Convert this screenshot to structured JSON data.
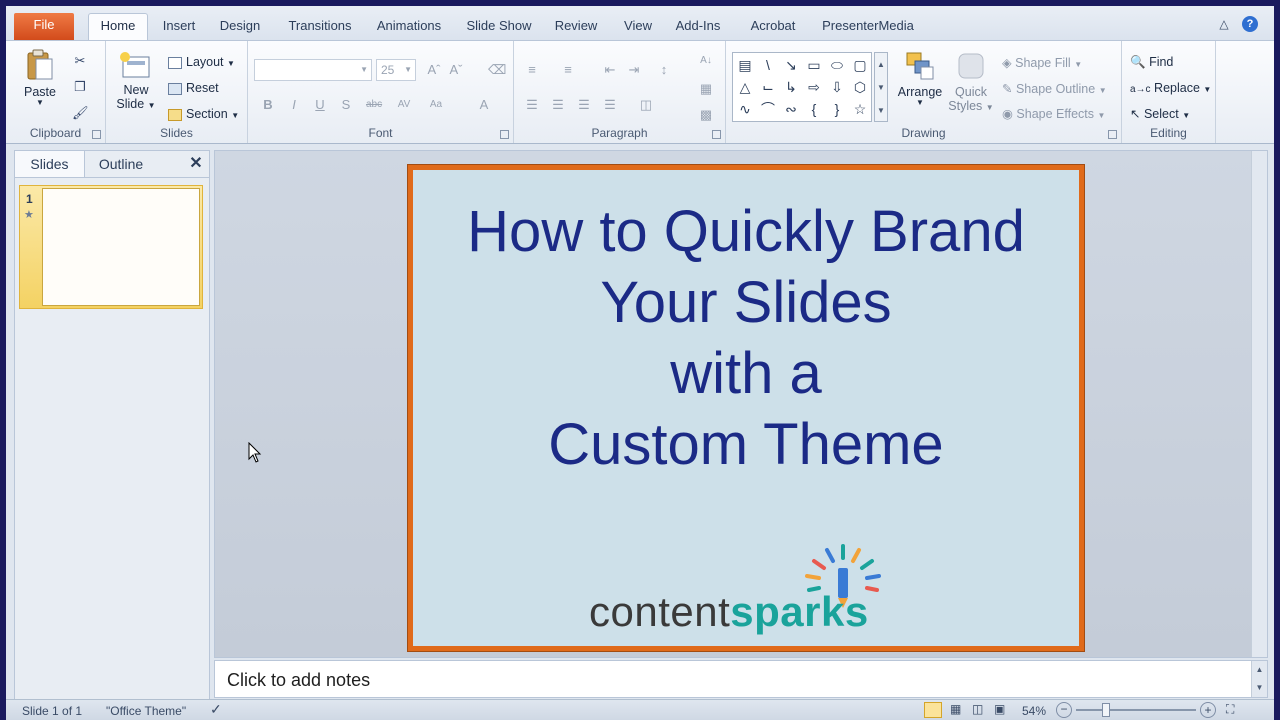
{
  "ribbon": {
    "tabs": [
      "File",
      "Home",
      "Insert",
      "Design",
      "Transitions",
      "Animations",
      "Slide Show",
      "Review",
      "View",
      "Add-Ins",
      "Acrobat",
      "PresenterMedia"
    ],
    "active_tab": "Home",
    "clipboard": {
      "paste": "Paste",
      "label": "Clipboard"
    },
    "slides": {
      "new_slide_line1": "New",
      "new_slide_line2": "Slide",
      "layout": "Layout",
      "reset": "Reset",
      "section": "Section",
      "label": "Slides"
    },
    "font": {
      "size": "25",
      "label": "Font"
    },
    "paragraph": {
      "label": "Paragraph"
    },
    "drawing": {
      "arrange": "Arrange",
      "quick_line1": "Quick",
      "quick_line2": "Styles",
      "shape_fill": "Shape Fill",
      "shape_outline": "Shape Outline",
      "shape_effects": "Shape Effects",
      "label": "Drawing"
    },
    "editing": {
      "find": "Find",
      "replace": "Replace",
      "select": "Select",
      "label": "Editing"
    }
  },
  "leftpane": {
    "tab_slides": "Slides",
    "tab_outline": "Outline",
    "thumb_number": "1"
  },
  "slide": {
    "title_lines": [
      "How to Quickly Brand",
      "Your Slides",
      "with a",
      "Custom Theme"
    ],
    "logo_part1": "content",
    "logo_part2": "sparks",
    "border_color": "#e06a1a",
    "bg_color": "#cde0e9",
    "title_color": "#1b2a86"
  },
  "notes": {
    "placeholder": "Click to add notes"
  },
  "status": {
    "slide_info": "Slide 1 of 1",
    "theme": "\"Office Theme\"",
    "zoom": "54%"
  }
}
